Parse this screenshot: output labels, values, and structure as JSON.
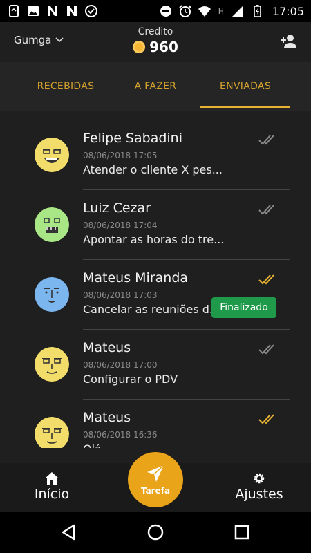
{
  "status_bar": {
    "time": "17:05",
    "left_icons": [
      "phone-data-icon",
      "image-icon",
      "n-icon",
      "n-icon",
      "check-circle-icon"
    ],
    "right_icons": [
      "dnd-icon",
      "alarm-icon",
      "wifi-icon",
      "h-network-icon",
      "signal-icon",
      "battery-icon"
    ],
    "network_label": "H"
  },
  "header": {
    "user_name": "Gumga",
    "credit_label": "Credito",
    "credit_value": "960"
  },
  "tabs": [
    {
      "label": "RECEBIDAS",
      "active": false
    },
    {
      "label": "A FAZER",
      "active": false
    },
    {
      "label": "ENVIADAS",
      "active": true
    }
  ],
  "tasks": [
    {
      "name": "Felipe Sabadini",
      "datetime": "08/06/2018 17:05",
      "message": "Atender o cliente X pes...",
      "checks_color": "#8a8a8a",
      "avatar_color": "#f2dc6a",
      "badge": ""
    },
    {
      "name": "Luiz Cezar",
      "datetime": "08/06/2018 17:04",
      "message": "Apontar as horas do tre...",
      "checks_color": "#8a8a8a",
      "avatar_color": "#a9e686",
      "badge": ""
    },
    {
      "name": "Mateus Miranda",
      "datetime": "08/06/2018 17:03",
      "message": "Cancelar as reuniões d...",
      "checks_color": "#e8b332",
      "avatar_color": "#7cb6ee",
      "badge": "Finalizado"
    },
    {
      "name": "Mateus",
      "datetime": "08/06/2018 17:00",
      "message": "Configurar o PDV",
      "checks_color": "#8a8a8a",
      "avatar_color": "#f2dc6a",
      "badge": ""
    },
    {
      "name": "Mateus",
      "datetime": "08/06/2018 16:36",
      "message": "Olá",
      "checks_color": "#e8b332",
      "avatar_color": "#f2dc6a",
      "badge": ""
    }
  ],
  "bottom_nav": {
    "home_label": "Início",
    "fab_label": "Tarefa",
    "settings_label": "Ajustes"
  },
  "colors": {
    "accent": "#e8b332",
    "fab": "#eaa41a",
    "badge_green": "#1e9a4a",
    "background": "#1f1f1f"
  }
}
